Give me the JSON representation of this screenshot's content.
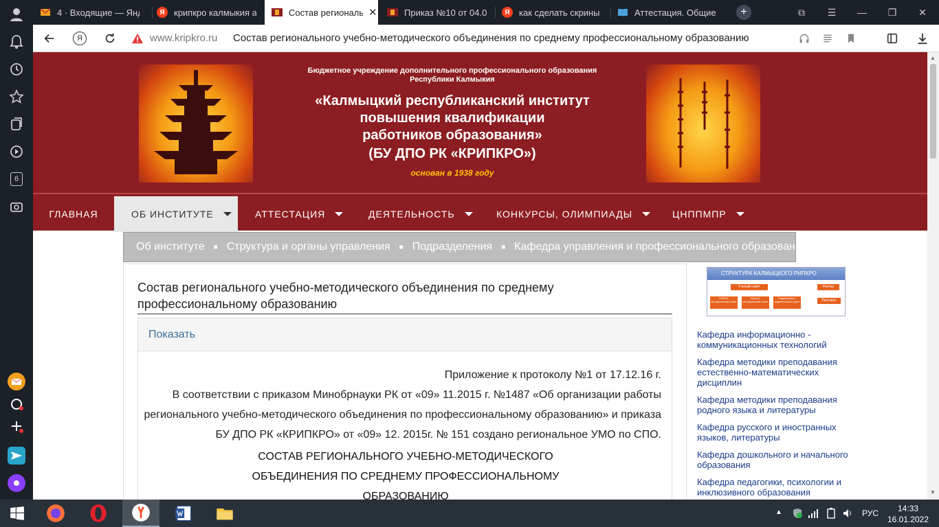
{
  "browser": {
    "tabs": [
      {
        "title": "4 · Входящие — Янд",
        "icon": "mail-icon"
      },
      {
        "title": "крипкро калмыкия а",
        "icon": "yandex-icon"
      },
      {
        "title": "Состав региональ",
        "icon": "site-icon",
        "active": true
      },
      {
        "title": "Приказ №10 от 04.0",
        "icon": "site-icon"
      },
      {
        "title": "как сделать скрины",
        "icon": "yandex-icon"
      },
      {
        "title": "Аттестация. Общие с",
        "icon": "book-icon"
      }
    ],
    "sidebar_badge": "6",
    "url_domain": "www.kripkro.ru",
    "url_title": "Состав регионального учебно-методического объединения по среднему профессиональному образованию",
    "yandex_letter": "Я"
  },
  "site": {
    "header": {
      "line1": "Бюджетное учреждение дополнительного профессионального образования",
      "line2": "Республики Калмыкия",
      "title1": "«Калмыцкий республиканский институт",
      "title2": "повышения квалификации",
      "title3": "работников образования»",
      "title4": "(БУ ДПО РК «КРИПКРО»)",
      "founded": "основан в 1938 году"
    },
    "menu": [
      {
        "label": "ГЛАВНАЯ"
      },
      {
        "label": "ОБ ИНСТИТУТЕ"
      },
      {
        "label": "АТТЕСТАЦИЯ"
      },
      {
        "label": "ДЕЯТЕЛЬНОСТЬ"
      },
      {
        "label": "КОНКУРСЫ, ОЛИМПИАДЫ"
      },
      {
        "label": "ЦНППМПР"
      }
    ],
    "breadcrumb": [
      "Об институте",
      "Структура и органы управления",
      "Подразделения",
      "Кафедра управления и профессионального образования"
    ],
    "article": {
      "title": "Состав регионального учебно-методического объединения по среднему профессиональному образованию",
      "spoiler_label": "Показать",
      "p1": "Приложение к протоколу №1 от 17.12.16 г.",
      "p2": "В соответствии с приказом Минобрнауки РК от «09» 11.2015 г. №1487 «Об организации работы",
      "p3": "регионального учебно-методического объединения по профессиональному образованию» и приказа",
      "p4": "БУ ДПО РК «КРИПКРО» от «09» 12. 2015г. № 151 создано региональное УМО по СПО.",
      "h1": "СОСТАВ РЕГИОНАЛЬНОГО УЧЕБНО-МЕТОДИЧЕСКОГО",
      "h2": "ОБЪЕДИНЕНИЯ ПО СРЕДНЕМУ ПРОФЕССИОНАЛЬНОМУ",
      "h3": "ОБРАЗОВАНИЮ"
    },
    "structure_image": {
      "title": "СТРУКТУРА КАЛМЫЦКОГО РИПКРО",
      "boxes": [
        "Ученый совет",
        "Ректор",
        "Учебно-методический совет",
        "Научно-методический совет",
        "Редакционно-издательский отдел",
        "Ректорат"
      ]
    },
    "sidebar_links": [
      "Кафедра информационно - коммуникационных технологий",
      "Кафедра методики преподавания естественно-математических дисциплин",
      "Кафедра методики преподавания родного языка и литературы",
      "Кафедра русского и иностранных языков, литературы",
      "Кафедра дошкольного и начального образования",
      "Кафедра педагогики, психологии и инклюзивного образования"
    ]
  },
  "taskbar": {
    "lang": "РУС",
    "time": "14:33",
    "date": "16.01.2022"
  },
  "colors": {
    "brand": "#8c1d22",
    "menu_active": "#e8e8e8",
    "breadcrumb": "#bdbdbd",
    "link": "#1a3a8a",
    "founded": "#ffc107"
  }
}
